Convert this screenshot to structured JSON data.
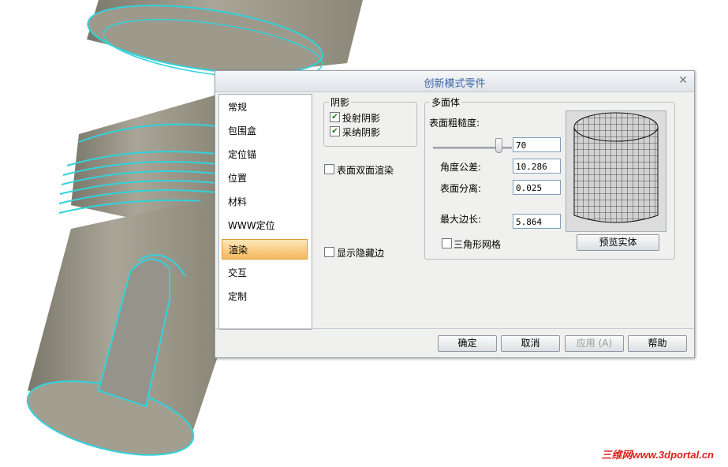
{
  "dialog": {
    "title": "创新模式零件",
    "close_glyph": "✕"
  },
  "nav": {
    "items": [
      {
        "label": "常规"
      },
      {
        "label": "包围盒"
      },
      {
        "label": "定位锚"
      },
      {
        "label": "位置"
      },
      {
        "label": "材料"
      },
      {
        "label": "WWW定位"
      },
      {
        "label": "渲染"
      },
      {
        "label": "交互"
      },
      {
        "label": "定制"
      }
    ],
    "selected": "渲染"
  },
  "shadow_group": {
    "legend": "阴影",
    "cast_shadow": {
      "label": "投射阴影",
      "checked": true
    },
    "receive_shadow": {
      "label": "采纳阴影",
      "checked": true
    }
  },
  "double_sided": {
    "label": "表面双面渲染",
    "checked": false
  },
  "show_hidden_edges": {
    "label": "显示隐藏边",
    "checked": false
  },
  "polyhedron": {
    "legend": "多面体",
    "roughness_label": "表面粗糙度:",
    "roughness_value": "70",
    "roughness_slider_level": 0.83,
    "angle_tolerance_label": "角度公差:",
    "angle_tolerance_value": "10.286",
    "surface_separation_label": "表面分离:",
    "surface_separation_value": "0.025",
    "max_edge_label": "最大边长:",
    "max_edge_value": "5.864",
    "triangle_mesh": {
      "label": "三角形网格",
      "checked": false
    },
    "preview_button": "预览实体"
  },
  "footer": {
    "ok": "确定",
    "cancel": "取消",
    "apply": "应用 (A)",
    "help": "帮助"
  },
  "watermark": "三维网www.3dportal.cn",
  "colors": {
    "part_body": "#8f8c7e",
    "part_edge": "#32d2dc",
    "selected_nav": "#f6b95c",
    "title_text": "#3a66a8",
    "watermark": "#e0201b"
  }
}
